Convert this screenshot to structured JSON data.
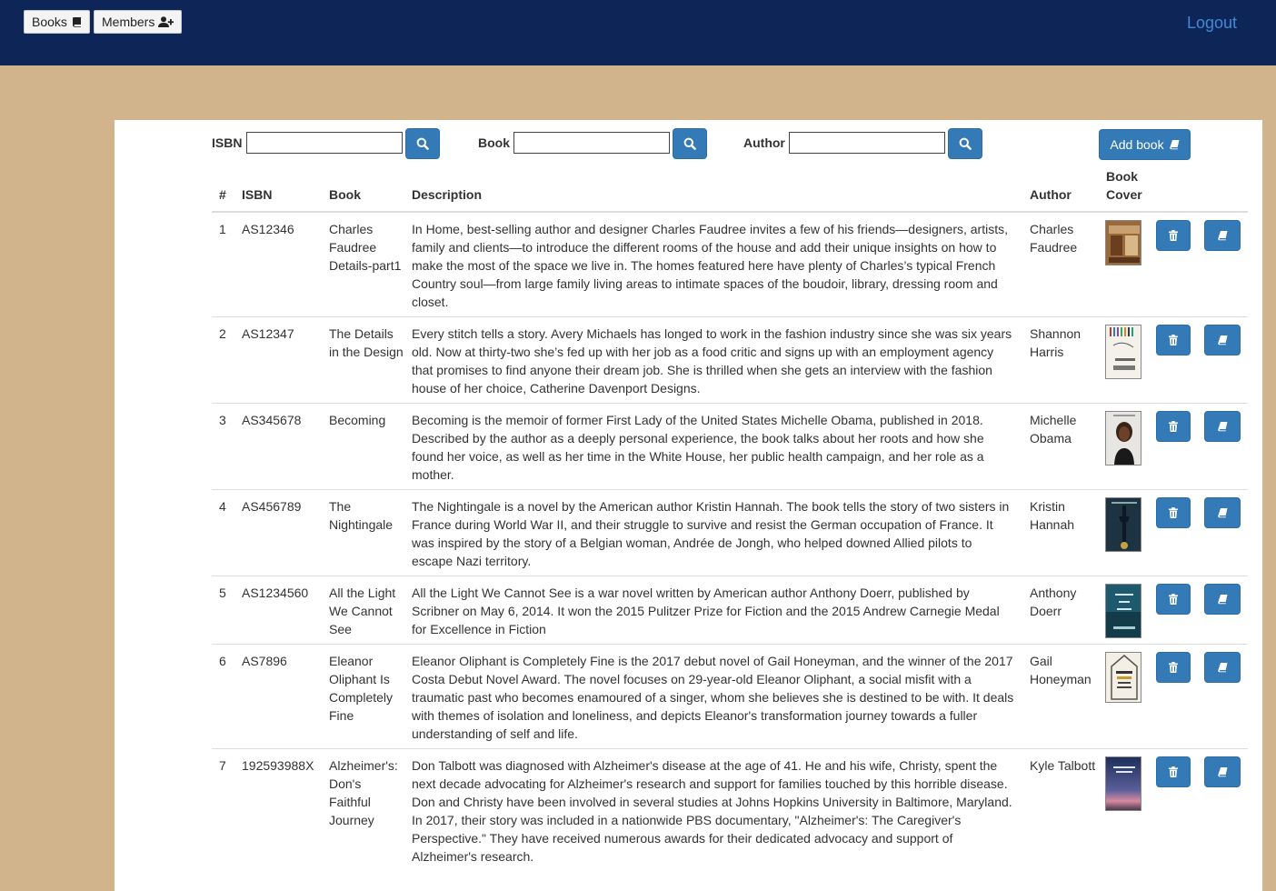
{
  "nav": {
    "books_label": "Books",
    "members_label": "Members",
    "logout_label": "Logout"
  },
  "search": {
    "isbn_label": "ISBN",
    "book_label": "Book",
    "author_label": "Author",
    "isbn_value": "",
    "book_value": "",
    "author_value": ""
  },
  "add_book_label": "Add book",
  "table": {
    "headers": {
      "num": "#",
      "isbn": "ISBN",
      "book": "Book",
      "description": "Description",
      "author": "Author",
      "cover_line1": "Book",
      "cover_line2": "Cover"
    },
    "rows": [
      {
        "num": "1",
        "isbn": "AS12346",
        "book": "Charles Faudree Details-part1",
        "description": "In Home, best-selling author and designer Charles Faudree invites a few of his friends—designers, artists, family and clients—to introduce the different rooms of the house and add their unique insights on how to make the most of the space we live in. The homes featured here have plenty of Charles’s typical French Country soul—from large family living areas to intimate spaces of the boudoir, library, dressing room and closet.",
        "author": "Charles Faudree"
      },
      {
        "num": "2",
        "isbn": "AS12347",
        "book": "The Details in the Design",
        "description": "Every stitch tells a story. Avery Michaels has longed to work in the fashion industry since she was six years old. Now at thirty-two she’s fed up with her job as a food critic and signs up with an employment agency that promises to find anyone their dream job. She is thrilled when she gets an interview with the fashion house of her choice, Catherine Davenport Designs.",
        "author": "Shannon Harris"
      },
      {
        "num": "3",
        "isbn": "AS345678",
        "book": "Becoming",
        "description": "Becoming is the memoir of former First Lady of the United States Michelle Obama, published in 2018. Described by the author as a deeply personal experience, the book talks about her roots and how she found her voice, as well as her time in the White House, her public health campaign, and her role as a mother.",
        "author": "Michelle Obama"
      },
      {
        "num": "4",
        "isbn": "AS456789",
        "book": "The Nightingale",
        "description": "The Nightingale is a novel by the American author Kristin Hannah. The book tells the story of two sisters in France during World War II, and their struggle to survive and resist the German occupation of France. It was inspired by the story of a Belgian woman, Andrée de Jongh, who helped downed Allied pilots to escape Nazi territory.",
        "author": "Kristin Hannah"
      },
      {
        "num": "5",
        "isbn": "AS1234560",
        "book": "All the Light We Cannot See",
        "description": "All the Light We Cannot See is a war novel written by American author Anthony Doerr, published by Scribner on May 6, 2014. It won the 2015 Pulitzer Prize for Fiction and the 2015 Andrew Carnegie Medal for Excellence in Fiction",
        "author": "Anthony Doerr"
      },
      {
        "num": "6",
        "isbn": "AS7896",
        "book": "Eleanor Oliphant Is Completely Fine",
        "description": "Eleanor Oliphant is Completely Fine is the 2017 debut novel of Gail Honeyman, and the winner of the 2017 Costa Debut Novel Award. The novel focuses on 29-year-old Eleanor Oliphant, a social misfit with a traumatic past who becomes enamoured of a singer, whom she believes she is destined to be with. It deals with themes of isolation and loneliness, and depicts Eleanor's transformation journey towards a fuller understanding of self and life.",
        "author": "Gail Honeyman"
      },
      {
        "num": "7",
        "isbn": "192593988X",
        "book": "Alzheimer's: Don's Faithful Journey",
        "description": "Don Talbott was diagnosed with Alzheimer's disease at the age of 41. He and his wife, Christy, spent the next decade advocating for Alzheimer's research and support for families touched by this horrible disease. Don and Christy have been involved in several studies at Johns Hopkins University in Baltimore, Maryland. In 2017, their story was included in a nationwide PBS documentary, \"Alzheimer's: The Caregiver's Perspective.\" They have received numerous awards for their dedicated advocacy and support of Alzheimer's research.",
        "author": "Kyle Talbott"
      }
    ]
  },
  "colors": {
    "topbar": "#0e2557",
    "background": "#d2b48c",
    "primary": "#337ab7",
    "logout": "#3f8ad8"
  }
}
